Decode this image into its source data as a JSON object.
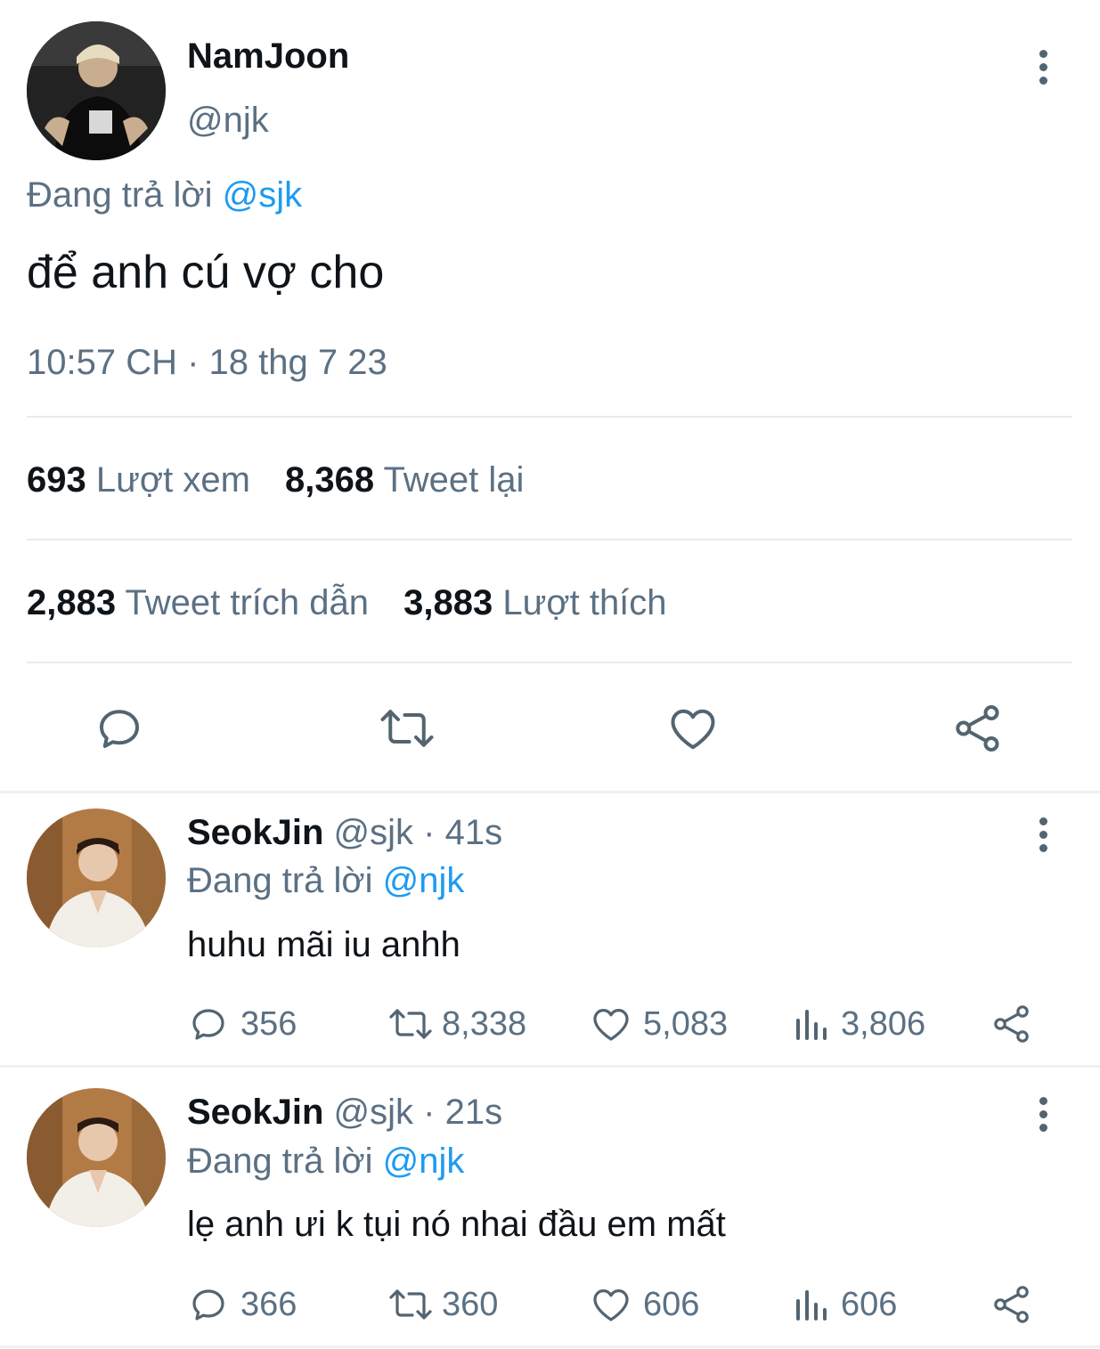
{
  "colors": {
    "gray": "#5b7083",
    "link": "#1d9bf0",
    "divider": "#e6ecf0",
    "icon": "#536471"
  },
  "main_tweet": {
    "display_name": "NamJoon",
    "handle": "@njk",
    "reply_prefix": "Đang trả lời",
    "reply_to": "@sjk",
    "text": "để anh cú vợ cho",
    "timestamp": "10:57 CH · 18 thg 7 23",
    "stats": {
      "views_count": "693",
      "views_label": "Lượt xem",
      "retweets_count": "8,368",
      "retweets_label": "Tweet lại",
      "quotes_count": "2,883",
      "quotes_label": "Tweet trích dẫn",
      "likes_count": "3,883",
      "likes_label": "Lượt thích"
    },
    "actions": [
      "reply-icon",
      "retweet-icon",
      "like-icon",
      "share-icon"
    ]
  },
  "replies": [
    {
      "display_name": "SeokJin",
      "handle": "@sjk",
      "time": "· 41s",
      "reply_prefix": "Đang trả lời",
      "reply_to": "@njk",
      "text": "huhu mãi iu anhh",
      "reply_count": "356",
      "retweet_count": "8,338",
      "like_count": "5,083",
      "view_count": "3,806"
    },
    {
      "display_name": "SeokJin",
      "handle": "@sjk",
      "time": "· 21s",
      "reply_prefix": "Đang trả lời",
      "reply_to": "@njk",
      "text": "lẹ anh ưi k tụi nó nhai đầu em mất",
      "reply_count": "366",
      "retweet_count": "360",
      "like_count": "606",
      "view_count": "606"
    }
  ]
}
